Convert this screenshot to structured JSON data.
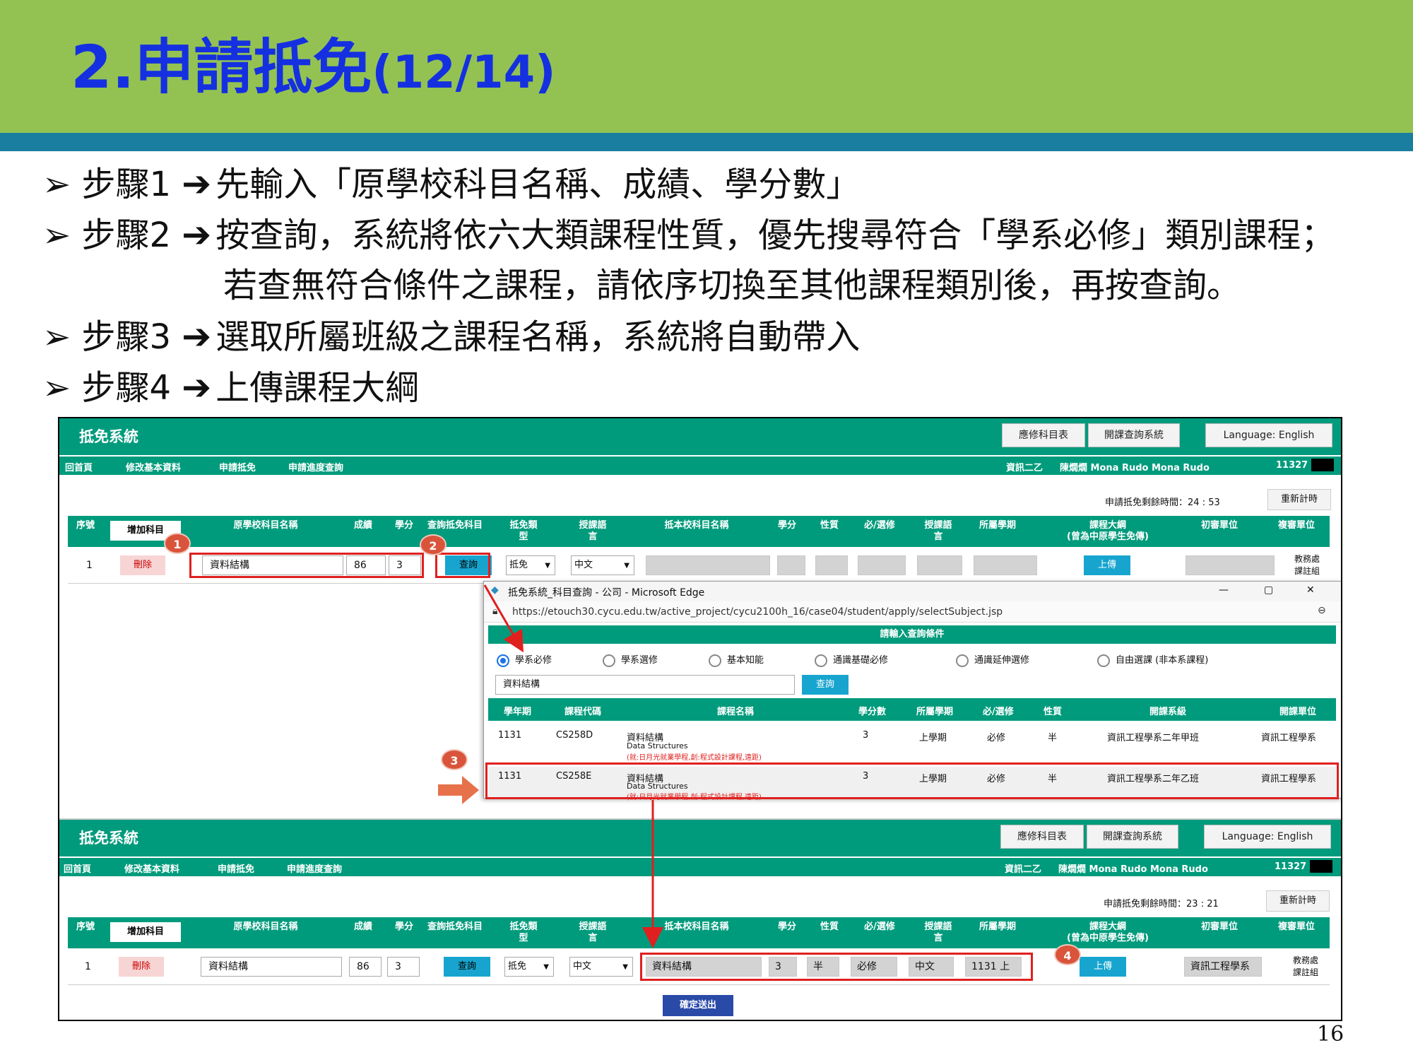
{
  "slide": {
    "title_main": "2.申請抵免",
    "title_sub": "(12/14)",
    "page_number": "16",
    "steps": [
      {
        "label": "步驟1",
        "text": "先輸入「原學校科目名稱、成績、學分數」"
      },
      {
        "label": "步驟2",
        "text": "按查詢，系統將依六大類課程性質，優先搜尋符合「學系必修」類別課程；",
        "text2": "若查無符合條件之課程，請依序切換至其他課程類別後，再按查詢。"
      },
      {
        "label": "步驟3",
        "text": "選取所屬班級之課程名稱，系統將自動帶入"
      },
      {
        "label": "步驟4",
        "text": "上傳課程大綱"
      }
    ]
  },
  "app": {
    "name": "抵免系統",
    "top_buttons": [
      "應修科目表",
      "開課查詢系統",
      "Language: English"
    ],
    "nav": [
      "回首頁",
      "修改基本資料",
      "申請抵免",
      "申請進度查詢"
    ],
    "user": {
      "dept": "資訊二乙",
      "name": "陳燗燗 Mona Rudo Mona Rudo",
      "id": "11327"
    },
    "timer_label": "申請抵免剩餘時間：",
    "timer_before": "24 : 53",
    "timer_after": "23 : 21",
    "reset_label": "重新計時",
    "add_subject": "增加科目",
    "columns": {
      "seq": "序號",
      "orig_name": "原學校科目名稱",
      "score": "成績",
      "credit": "學分",
      "query": "查詢抵免科目",
      "type": "抵免類型",
      "lang": "授課語言",
      "target_name": "抵本校科目名稱",
      "t_credit": "學分",
      "nature": "性質",
      "req": "必/選修",
      "t_lang": "授課語言",
      "semester": "所屬學期",
      "syllabus": "課程大綱",
      "syllabus_note": "(曾為中原學生免傳)",
      "first_unit": "初審單位",
      "review_unit": "複審單位"
    },
    "row": {
      "seq": "1",
      "delete": "刪除",
      "orig_name": "資料結構",
      "score": "86",
      "credit": "3",
      "query": "查詢",
      "type": "抵免",
      "lang": "中文",
      "upload": "上傳",
      "review_unit": [
        "教務處",
        "課註組"
      ]
    },
    "filled": {
      "target_name": "資料結構",
      "credit": "3",
      "nature": "半",
      "req": "必修",
      "lang": "中文",
      "semester": "1131 上",
      "first_unit": "資訊工程學系"
    },
    "submit": "確定送出"
  },
  "popup": {
    "title": "抵免系統_科目查詢 - 公司 - Microsoft Edge",
    "url": "https://etouch30.cycu.edu.tw/active_project/cycu2100h_16/case04/student/apply/selectSubject.jsp",
    "window_controls": [
      "—",
      "▢",
      "✕"
    ],
    "condition": "請輸入查詢條件",
    "radios": [
      "學系必修",
      "學系選修",
      "基本知能",
      "通識基礎必修",
      "通識延伸選修",
      "自由選課 (非本系課程)"
    ],
    "radio_selected": 0,
    "search_value": "資料結構",
    "search_btn": "查詢",
    "headers": [
      "學年期",
      "課程代碼",
      "課程名稱",
      "學分數",
      "所屬學期",
      "必/選修",
      "性質",
      "開課系級",
      "開課單位"
    ],
    "rows": [
      {
        "term": "1131",
        "code": "CS258D",
        "name": "資料結構",
        "en": "Data Structures",
        "note": "(就:日月光就業學程,創:程式設計課程,遠距)",
        "credit": "3",
        "sem": "上學期",
        "req": "必修",
        "nature": "半",
        "class": "資訊工程學系二年甲班",
        "unit": "資訊工程學系"
      },
      {
        "term": "1131",
        "code": "CS258E",
        "name": "資料結構",
        "en": "Data Structures",
        "note": "(就:日月光就業學程,創:程式設計課程,遠距)",
        "credit": "3",
        "sem": "上學期",
        "req": "必修",
        "nature": "半",
        "class": "資訊工程學系二年乙班",
        "unit": "資訊工程學系"
      }
    ]
  },
  "badges": [
    "1",
    "2",
    "3",
    "4"
  ],
  "colors": {
    "header_green": "#93c253",
    "header_blue": "#1a7ea0",
    "title_blue": "#1530e0",
    "app_green": "#009b7c",
    "highlight_red": "#e0201e",
    "badge": "#d9543b"
  }
}
